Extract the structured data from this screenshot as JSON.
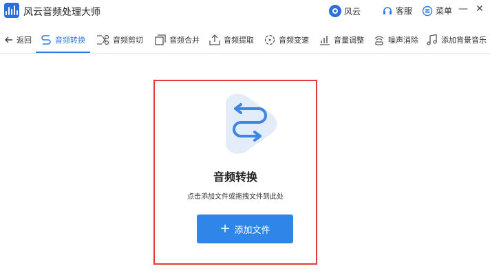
{
  "app": {
    "title": "风云音频处理大师"
  },
  "titlebar": {
    "account_label": "风云",
    "service_label": "客服",
    "menu_label": "菜单",
    "minimize": "—",
    "close": "✕"
  },
  "toolbar": {
    "back_label": "返回",
    "items": [
      {
        "label": "音频转换",
        "icon": "convert-icon",
        "active": true
      },
      {
        "label": "音频剪切",
        "icon": "scissors-icon"
      },
      {
        "label": "音频合并",
        "icon": "merge-icon"
      },
      {
        "label": "音频提取",
        "icon": "extract-icon"
      },
      {
        "label": "音频变速",
        "icon": "speed-icon"
      },
      {
        "label": "音量调整",
        "icon": "volume-icon"
      },
      {
        "label": "噪声消除",
        "icon": "noise-icon"
      },
      {
        "label": "添加背景音乐",
        "icon": "music-icon"
      }
    ]
  },
  "main": {
    "title": "音频转换",
    "subtitle": "点击添加文件或拖拽文件到此处",
    "add_button_label": "添加文件"
  },
  "colors": {
    "accent": "#2a7be4",
    "highlight_border": "#e03a3a",
    "button": "#2f86e8",
    "hero_bg": "#e3ecf9"
  }
}
